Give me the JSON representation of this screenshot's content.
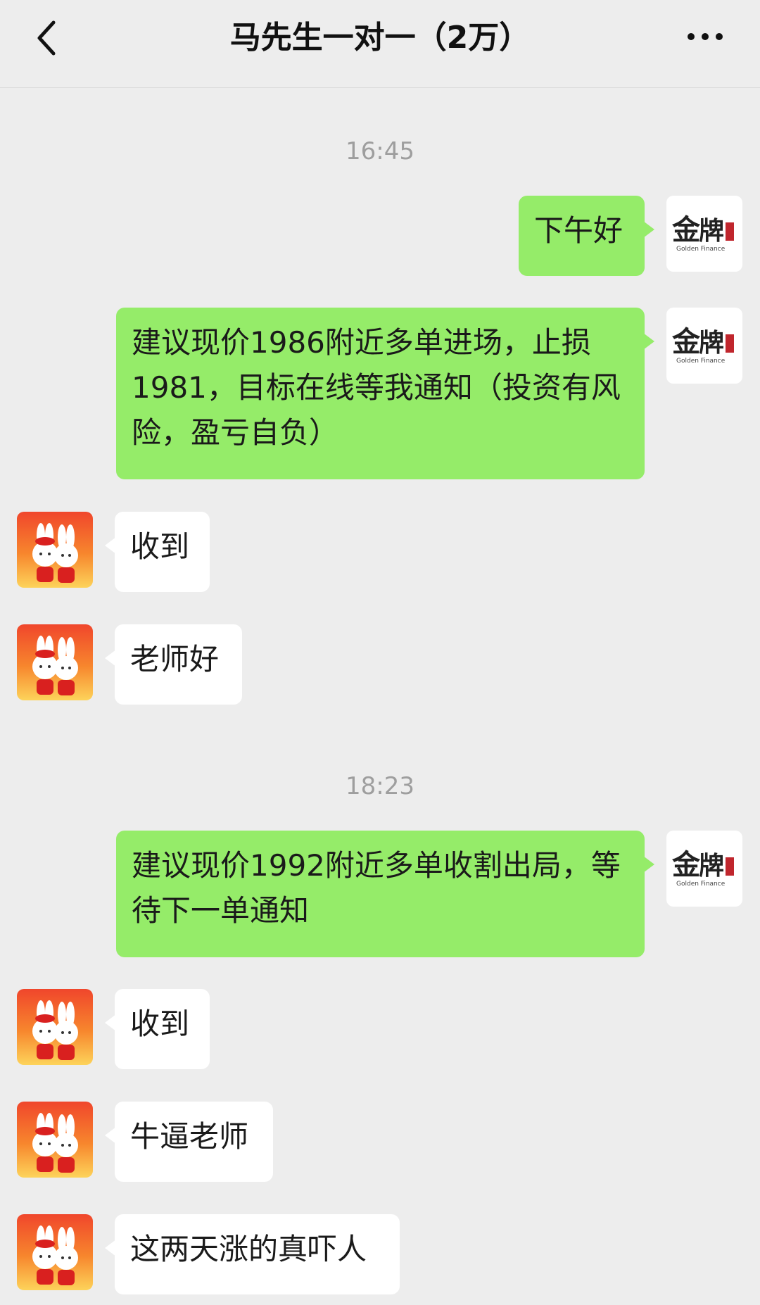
{
  "header": {
    "back_icon": "chevron-left-icon",
    "title": "马先生一对一（2万）",
    "more_icon": "more-dots-icon"
  },
  "avatars": {
    "me": {
      "icon": "golden-finance-logo",
      "text": "金牌 Golden Finance"
    },
    "other": {
      "icon": "rabbit-couple-avatar"
    }
  },
  "timestamps": [
    "16:45",
    "18:23"
  ],
  "messages": [
    {
      "from": "me",
      "text": "下午好"
    },
    {
      "from": "me",
      "text": "建议现价1986附近多单进场，止损1981，目标在线等我通知（投资有风险，盈亏自负）"
    },
    {
      "from": "other",
      "text": "收到"
    },
    {
      "from": "other",
      "text": "老师好"
    },
    {
      "from": "me",
      "text": "建议现价1992附近多单收割出局，等待下一单通知"
    },
    {
      "from": "other",
      "text": "收到"
    },
    {
      "from": "other",
      "text": "牛逼老师"
    },
    {
      "from": "other",
      "text": "这两天涨的真吓人"
    }
  ],
  "colors": {
    "background": "#ededed",
    "my_bubble": "#95ec69",
    "their_bubble": "#ffffff",
    "timestamp": "#9e9e9e"
  }
}
